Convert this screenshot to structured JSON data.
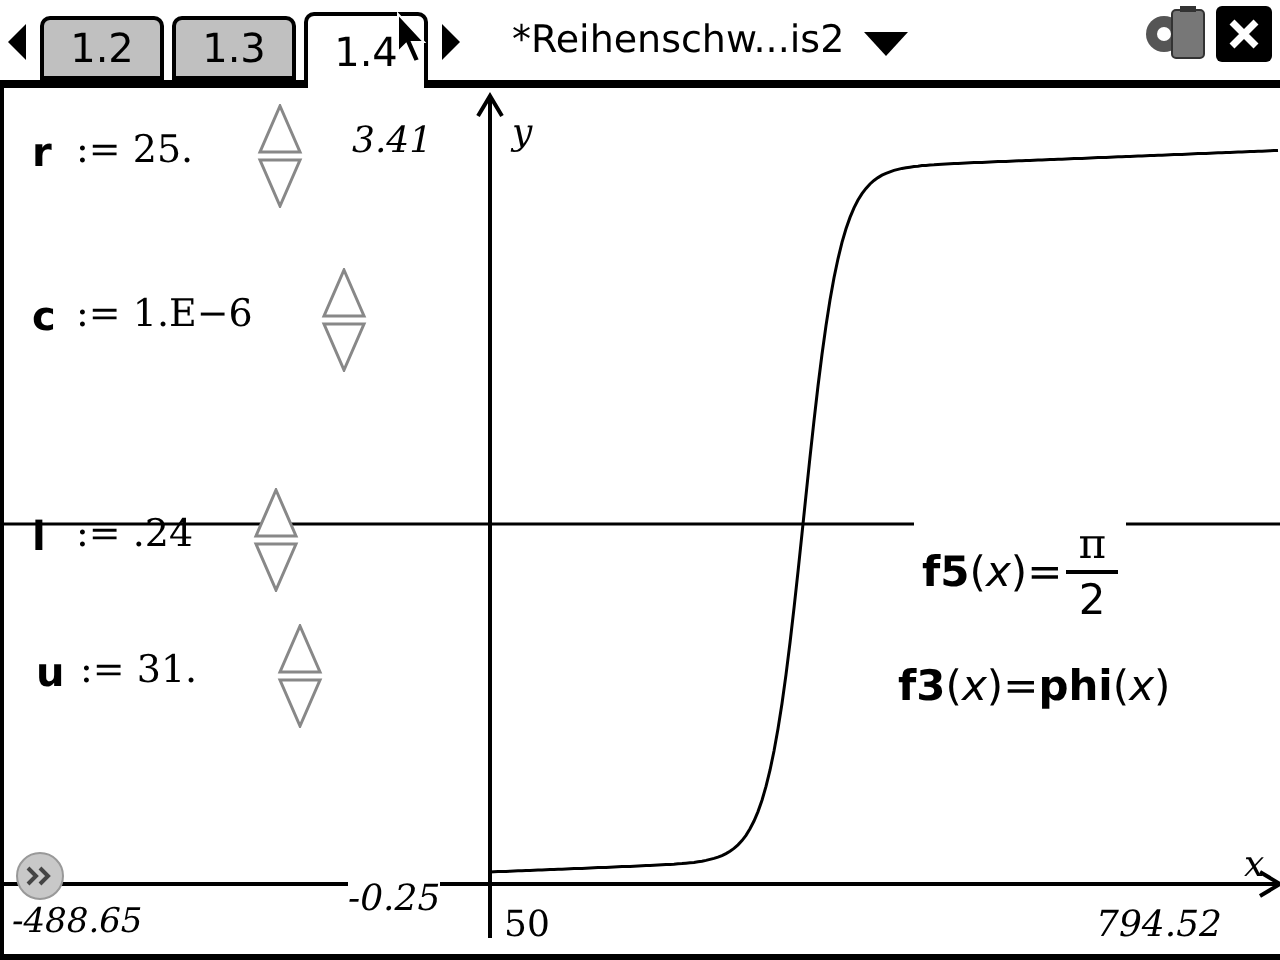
{
  "tabs": [
    {
      "label": "1.2",
      "selected": false
    },
    {
      "label": "1.3",
      "selected": false
    },
    {
      "label": "1.4",
      "selected": true
    }
  ],
  "document_title": "*Reihenschw...is2",
  "sliders": [
    {
      "name": "r",
      "value": ":= 25."
    },
    {
      "name": "c",
      "value": ":= 1.E−6"
    },
    {
      "name": "l",
      "value": ":= .24"
    },
    {
      "name": "u",
      "value": ":= 31."
    }
  ],
  "graph": {
    "y_max": "3.41",
    "y_label": "y",
    "x_label": "x",
    "x_min": "-488.65",
    "y_min": "-0.25",
    "x_origin_label": "50",
    "x_max": "794.52",
    "functions": [
      {
        "kind": "fraction",
        "lhs": "**f5**(*x*)=",
        "numerator": "π",
        "denominator": "2"
      },
      {
        "kind": "plain",
        "lhs": "**f3**(*x*)=**phi**(*x*)"
      }
    ]
  }
}
